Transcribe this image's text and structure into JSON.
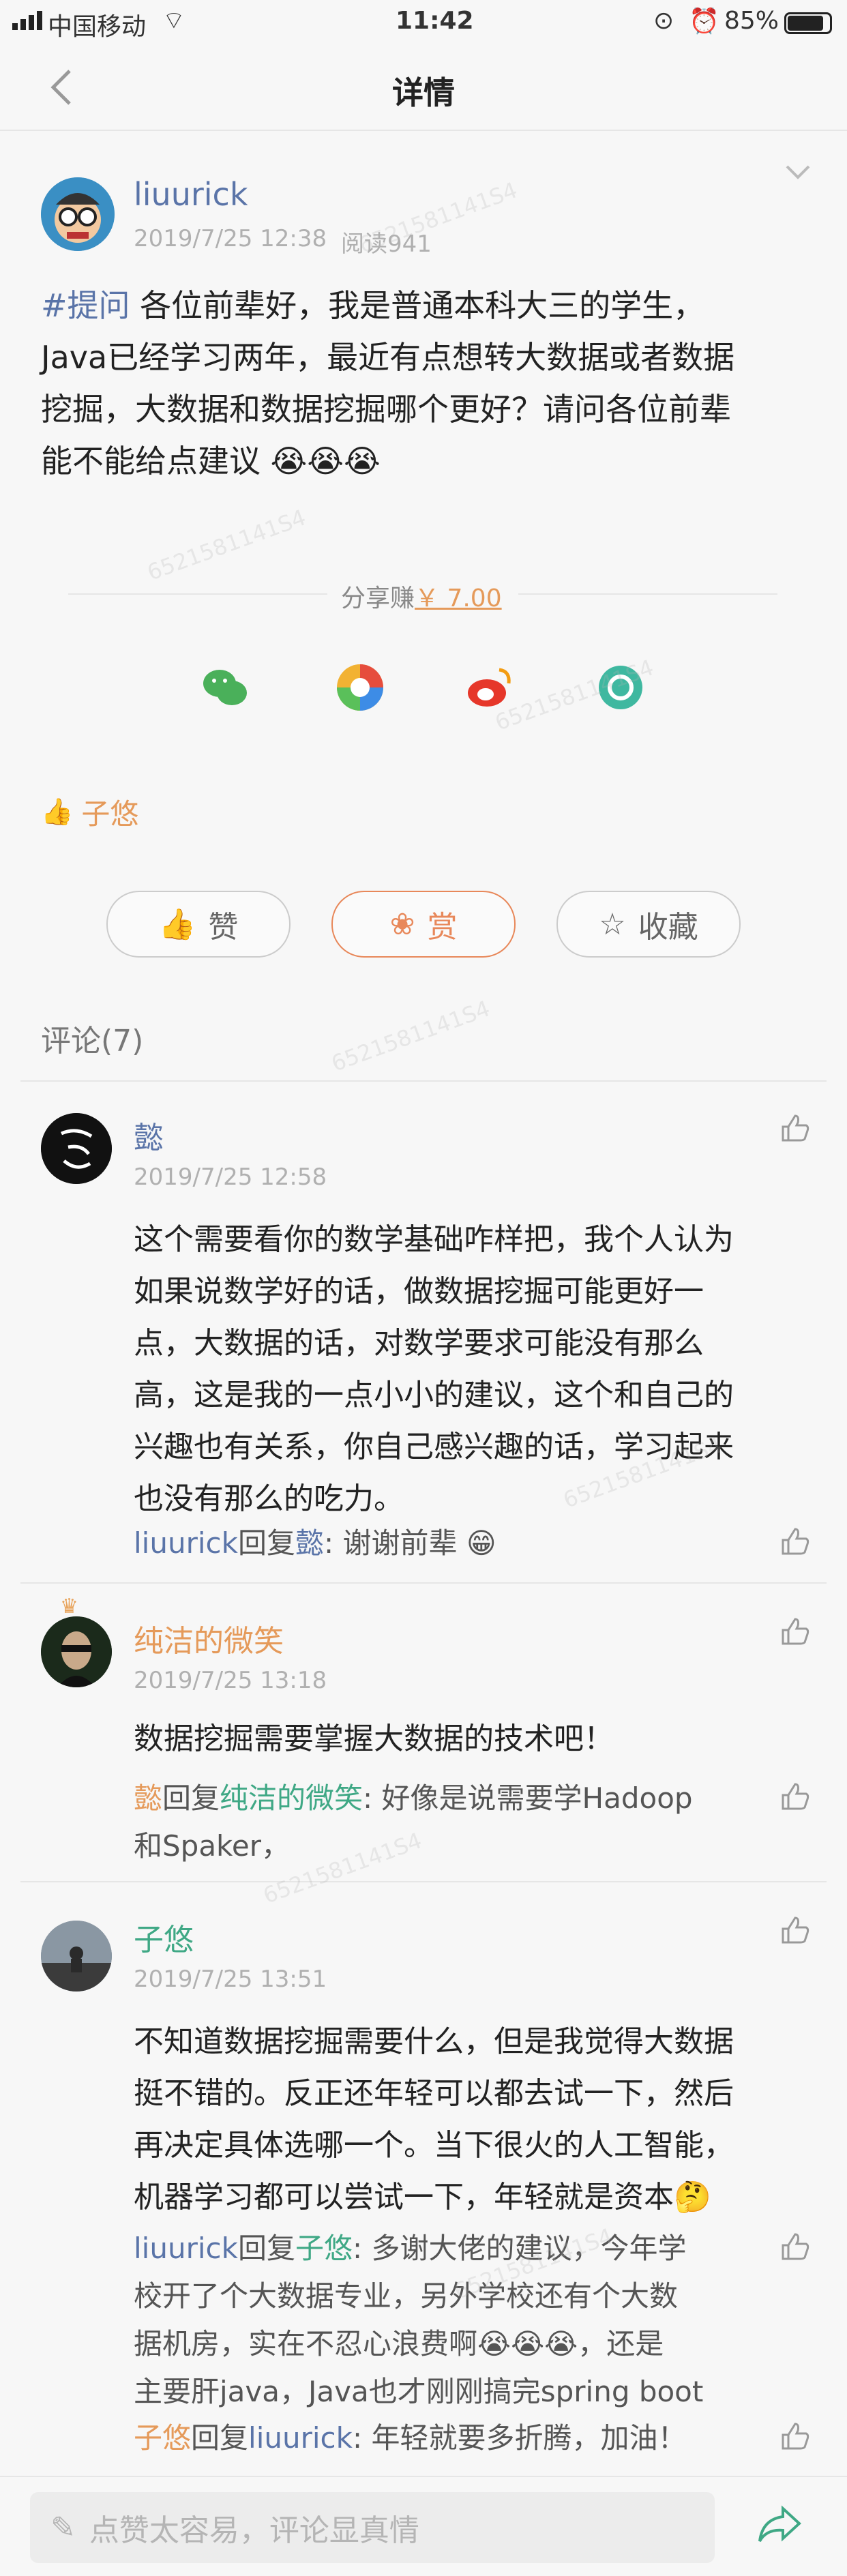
{
  "status": {
    "carrier": "中国移动",
    "time": "11:42",
    "battery": "85%"
  },
  "nav": {
    "title": "详情"
  },
  "post": {
    "author": "liuurick",
    "date": "2019/7/25 12:38",
    "views": "阅读941",
    "tag": "#提问",
    "text_line1": "各位前辈好，我是普通本科大三的学生，",
    "text_line2": "Java已经学习两年，最近有点想转大数据或者数据",
    "text_line3": "挖掘，大数据和数据挖掘哪个更好？请问各位前辈",
    "text_line4": "能不能给点建议"
  },
  "share": {
    "label": "分享赚",
    "amount": "￥ 7.00"
  },
  "likers": {
    "names": "子悠"
  },
  "actions": {
    "like": "赞",
    "reward": "赏",
    "collect": "收藏"
  },
  "comments_header": "评论(7)",
  "comments": [
    {
      "author": "懿",
      "date": "2019/7/25 12:58",
      "lines": [
        "这个需要看你的数学基础咋样把，我个人认为",
        "如果说数学好的话，做数据挖掘可能更好一",
        "点，大数据的话，对数学要求可能没有那么",
        "高，这是我的一点小小的建议，这个和自己的",
        "兴趣也有关系，你自己感兴趣的话，学习起来",
        "也没有那么的吃力。"
      ],
      "replies": [
        {
          "from": "liuurick",
          "verb": "回复",
          "to": "懿",
          "text": ": 谢谢前辈"
        }
      ]
    },
    {
      "author": "纯洁的微笑",
      "date": "2019/7/25 13:18",
      "lines": [
        "数据挖掘需要掌握大数据的技术吧！"
      ],
      "replies": [
        {
          "from": "懿",
          "verb": "回复",
          "to": "纯洁的微笑",
          "text": ": 好像是说需要学Hadoop",
          "text2": "和Spaker，"
        }
      ]
    },
    {
      "author": "子悠",
      "date": "2019/7/25 13:51",
      "lines": [
        "不知道数据挖掘需要什么，但是我觉得大数据",
        "挺不错的。反正还年轻可以都去试一下，然后",
        "再决定具体选哪一个。当下很火的人工智能，",
        "机器学习都可以尝试一下，年轻就是资本"
      ],
      "replies": [
        {
          "from": "liuurick",
          "verb": "回复",
          "to": "子悠",
          "text": ": 多谢大佬的建议，今年学",
          "text2": "校开了个大数据专业，另外学校还有个大数",
          "text3": "据机房，实在不忍心浪费啊",
          "text4": "，还是",
          "text5": "主要肝java，Java也才刚刚搞完spring boot"
        },
        {
          "from": "子悠",
          "verb": "回复",
          "to": "liuurick",
          "text": ": 年轻就要多折腾，加油！"
        }
      ]
    }
  ],
  "bottom": {
    "placeholder": "点赞太容易，评论显真情"
  },
  "watermark": "6521581141S4",
  "colors": {
    "link": "#5a74a8",
    "orange": "#e59a5a",
    "green": "#3fa885",
    "reward": "#e8885a"
  }
}
